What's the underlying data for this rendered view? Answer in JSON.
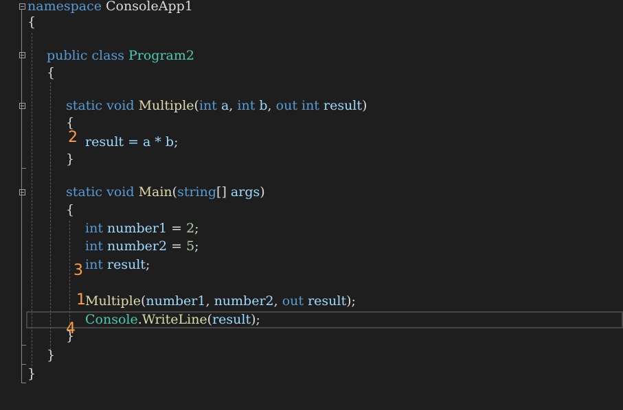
{
  "editor": {
    "lines": {
      "l1": {
        "kw": "namespace",
        "name": " ConsoleApp1"
      },
      "l2": {
        "brace": "{"
      },
      "l4": {
        "kw1": "public",
        "kw2": " class",
        "name": " Program2"
      },
      "l5": {
        "brace": "{"
      },
      "l7": {
        "kw1": "static",
        "kw2": " void",
        "method": " Multiple",
        "p1": "(",
        "t1": "int",
        "a": " a",
        "c1": ", ",
        "t2": "int",
        "b": " b",
        "c2": ", ",
        "kw3": "out",
        "t3": " int",
        "r": " result",
        "p2": ")"
      },
      "l8": {
        "brace": "{"
      },
      "l9": {
        "text": "result = a * b;"
      },
      "l10": {
        "brace": "}"
      },
      "l12": {
        "kw1": "static",
        "kw2": " void",
        "method": " Main",
        "p1": "(",
        "t1": "string",
        "br": "[] ",
        "args": "args",
        "p2": ")"
      },
      "l13": {
        "brace": "{"
      },
      "l14": {
        "t": "int",
        "var": " number1",
        "eq": " = ",
        "num": "2",
        "semi": ";"
      },
      "l15": {
        "t": "int",
        "var": " number2",
        "eq": " = ",
        "num": "5",
        "semi": ";"
      },
      "l16": {
        "t": "int",
        "var": " result",
        "semi": ";"
      },
      "l18": {
        "method": "Multiple",
        "p1": "(",
        "a1": "number1",
        "c1": ", ",
        "a2": "number2",
        "c2": ", ",
        "kw": "out",
        "r": " result",
        "p2": ");"
      },
      "l19": {
        "type": "Console",
        "dot": ".",
        "method": "WriteLine",
        "p1": "(",
        "arg": "result",
        "p2": ");"
      },
      "l20": {
        "brace": "}"
      },
      "l21": {
        "brace": "}"
      },
      "l22": {
        "brace": "}"
      }
    },
    "annotations": {
      "a1": "1",
      "a2": "2",
      "a3": "3",
      "a4": "4"
    },
    "colors": {
      "background": "#1e1e1e",
      "keyword": "#569cd6",
      "type": "#4ec9b0",
      "method": "#dcdcaa",
      "identifier": "#9cdcfe",
      "number": "#b5cea8",
      "annotation": "#ff9f43"
    },
    "icons": [
      "collapse-icon"
    ]
  }
}
